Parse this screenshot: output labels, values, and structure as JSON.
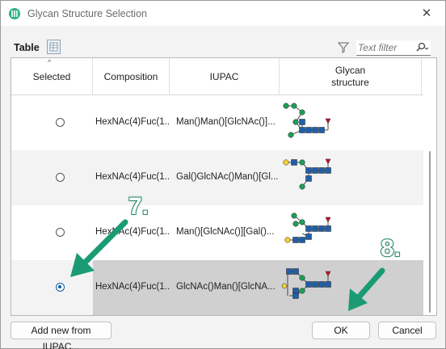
{
  "window": {
    "title": "Glycan Structure Selection",
    "close_glyph": "✕"
  },
  "toolbar": {
    "label": "Table",
    "filter_placeholder": "Text filter"
  },
  "table": {
    "columns": [
      "Selected",
      "Composition",
      "IUPAC",
      "Glycan\nstructure"
    ],
    "rows": [
      {
        "composition": "HexNAc(4)Fuc(1...",
        "iupac": "Man()Man()[GlcNAc()]...",
        "selected": false
      },
      {
        "composition": "HexNAc(4)Fuc(1...",
        "iupac": "Gal()GlcNAc()Man()[Gl...",
        "selected": false
      },
      {
        "composition": "HexNAc(4)Fuc(1...",
        "iupac": "Man()[GlcNAc()][Gal()...",
        "selected": false
      },
      {
        "composition": "HexNAc(4)Fuc(1...",
        "iupac": "GlcNAc()Man()[GlcNA...",
        "selected": true
      }
    ]
  },
  "buttons": {
    "add_iupac": "Add new from IUPAC...",
    "ok": "OK",
    "cancel": "Cancel"
  },
  "annotations": {
    "step7": "7.",
    "step8": "8."
  },
  "colors": {
    "accent": "#1a9b73",
    "selection": "#0a5aa6",
    "hexnac": "#1f5fa8",
    "mannose": "#1f9e57",
    "galactose": "#f2cf3b",
    "fucose": "#c8102e"
  }
}
